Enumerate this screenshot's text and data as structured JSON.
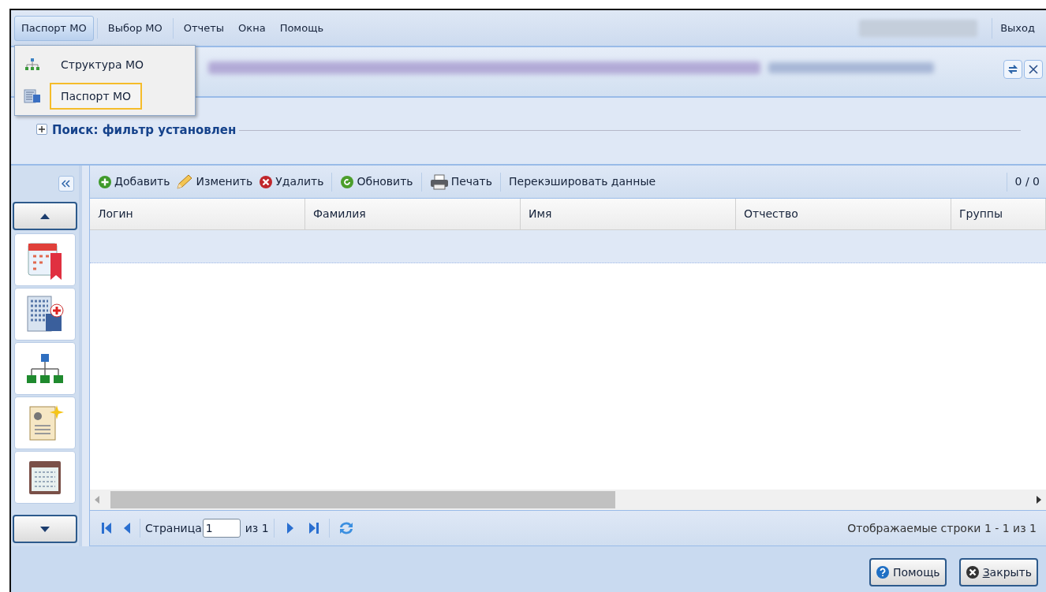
{
  "menu_bar": {
    "items": [
      {
        "label": "Паспорт МО",
        "selected": true
      },
      {
        "label": "Выбор МО",
        "selected": false
      },
      {
        "label": "Отчеты",
        "selected": false
      },
      {
        "label": "Окна",
        "selected": false
      },
      {
        "label": "Помощь",
        "selected": false
      }
    ],
    "exit": "Выход"
  },
  "dropdown": {
    "items": [
      {
        "label": "Структура МО",
        "kind": "org",
        "selected": false
      },
      {
        "label": "Паспорт МО",
        "kind": "building",
        "selected": true
      }
    ]
  },
  "filter": {
    "legend": "Поиск: фильтр установлен",
    "expanded": false
  },
  "toolbar": {
    "buttons": [
      {
        "label": "Добавить",
        "kind": "add"
      },
      {
        "label": "Изменить",
        "kind": "edit"
      },
      {
        "label": "Удалить",
        "kind": "delete"
      },
      {
        "label": "Обновить",
        "kind": "refresh"
      },
      {
        "label": "Печать",
        "kind": "print"
      },
      {
        "label": "Перекэшировать данные",
        "kind": "text"
      }
    ],
    "counter": "0 / 0"
  },
  "table": {
    "columns": [
      "Логин",
      "Фамилия",
      "Имя",
      "Отчество",
      "Группы"
    ]
  },
  "pager": {
    "page_label": "Страница",
    "page": "1",
    "of": "из 1",
    "status": "Отображаемые строки 1 - 1 из 1"
  },
  "footer": {
    "buttons": [
      {
        "label": "Помощь",
        "kind": "help"
      },
      {
        "label": "Закрыть",
        "kind": "close"
      }
    ]
  }
}
